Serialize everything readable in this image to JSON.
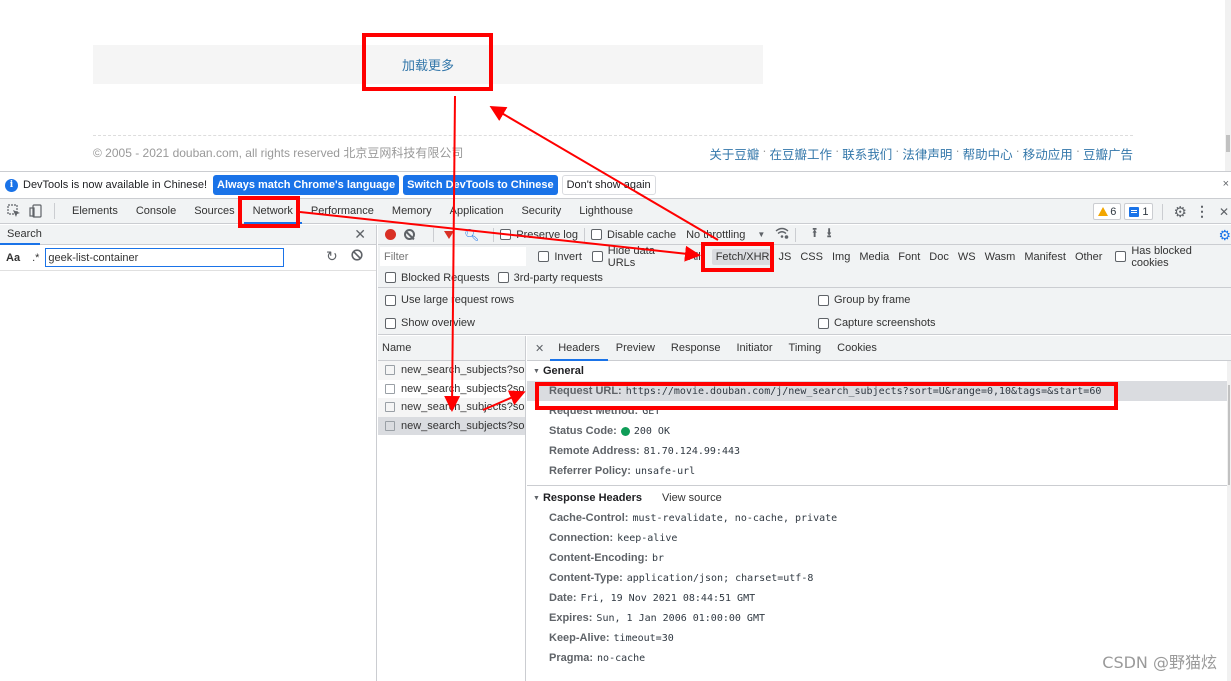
{
  "page": {
    "load_more": "加载更多",
    "copyright": "© 2005 - 2021 douban.com, all rights reserved 北京豆网科技有限公司",
    "footer_links": [
      "关于豆瓣",
      "在豆瓣工作",
      "联系我们",
      "法律声明",
      "帮助中心",
      "移动应用",
      "豆瓣广告"
    ],
    "footer_sep": "·"
  },
  "infobar": {
    "message": "DevTools is now available in Chinese!",
    "btn_match": "Always match Chrome's language",
    "btn_switch": "Switch DevTools to Chinese",
    "btn_dismiss": "Don't show again",
    "close": "×"
  },
  "tabs": {
    "items": [
      "Elements",
      "Console",
      "Sources",
      "Network",
      "Performance",
      "Memory",
      "Application",
      "Security",
      "Lighthouse"
    ],
    "active": "Network",
    "warnings": "6",
    "messages": "1"
  },
  "search": {
    "tab_label": "Search",
    "case_label": "Aa",
    "regex_label": ".*",
    "query": "geek-list-container"
  },
  "network": {
    "preserve_log": "Preserve log",
    "disable_cache": "Disable cache",
    "throttling": "No throttling",
    "filter_placeholder": "Filter",
    "invert": "Invert",
    "hide_data_urls": "Hide data URLs",
    "types": [
      "All",
      "Fetch/XHR",
      "JS",
      "CSS",
      "Img",
      "Media",
      "Font",
      "Doc",
      "WS",
      "Wasm",
      "Manifest",
      "Other"
    ],
    "active_type": "Fetch/XHR",
    "has_blocked_cookies": "Has blocked cookies",
    "blocked_requests": "Blocked Requests",
    "third_party": "3rd-party requests",
    "large_rows": "Use large request rows",
    "show_overview": "Show overview",
    "group_by_frame": "Group by frame",
    "capture_screenshots": "Capture screenshots",
    "name_header": "Name",
    "requests": [
      "new_search_subjects?so...",
      "new_search_subjects?so...",
      "new_search_subjects?so...",
      "new_search_subjects?so..."
    ]
  },
  "detail": {
    "tabs": [
      "Headers",
      "Preview",
      "Response",
      "Initiator",
      "Timing",
      "Cookies"
    ],
    "active_tab": "Headers",
    "general_title": "General",
    "general": [
      {
        "key": "Request URL:",
        "value": "https://movie.douban.com/j/new_search_subjects?sort=U&range=0,10&tags=&start=60"
      },
      {
        "key": "Request Method:",
        "value": "GET"
      },
      {
        "key": "Status Code:",
        "value": "200 OK"
      },
      {
        "key": "Remote Address:",
        "value": "81.70.124.99:443"
      },
      {
        "key": "Referrer Policy:",
        "value": "unsafe-url"
      }
    ],
    "response_title": "Response Headers",
    "view_source": "View source",
    "response": [
      {
        "key": "Cache-Control:",
        "value": "must-revalidate, no-cache, private"
      },
      {
        "key": "Connection:",
        "value": "keep-alive"
      },
      {
        "key": "Content-Encoding:",
        "value": "br"
      },
      {
        "key": "Content-Type:",
        "value": "application/json; charset=utf-8"
      },
      {
        "key": "Date:",
        "value": "Fri, 19 Nov 2021 08:44:51 GMT"
      },
      {
        "key": "Expires:",
        "value": "Sun, 1 Jan 2006 01:00:00 GMT"
      },
      {
        "key": "Keep-Alive:",
        "value": "timeout=30"
      },
      {
        "key": "Pragma:",
        "value": "no-cache"
      }
    ]
  },
  "watermark": "CSDN @野猫炫",
  "colors": {
    "accent": "#1a73e8",
    "annotation": "#ff0000",
    "link": "#3377aa",
    "status_ok": "#0f9d58"
  }
}
